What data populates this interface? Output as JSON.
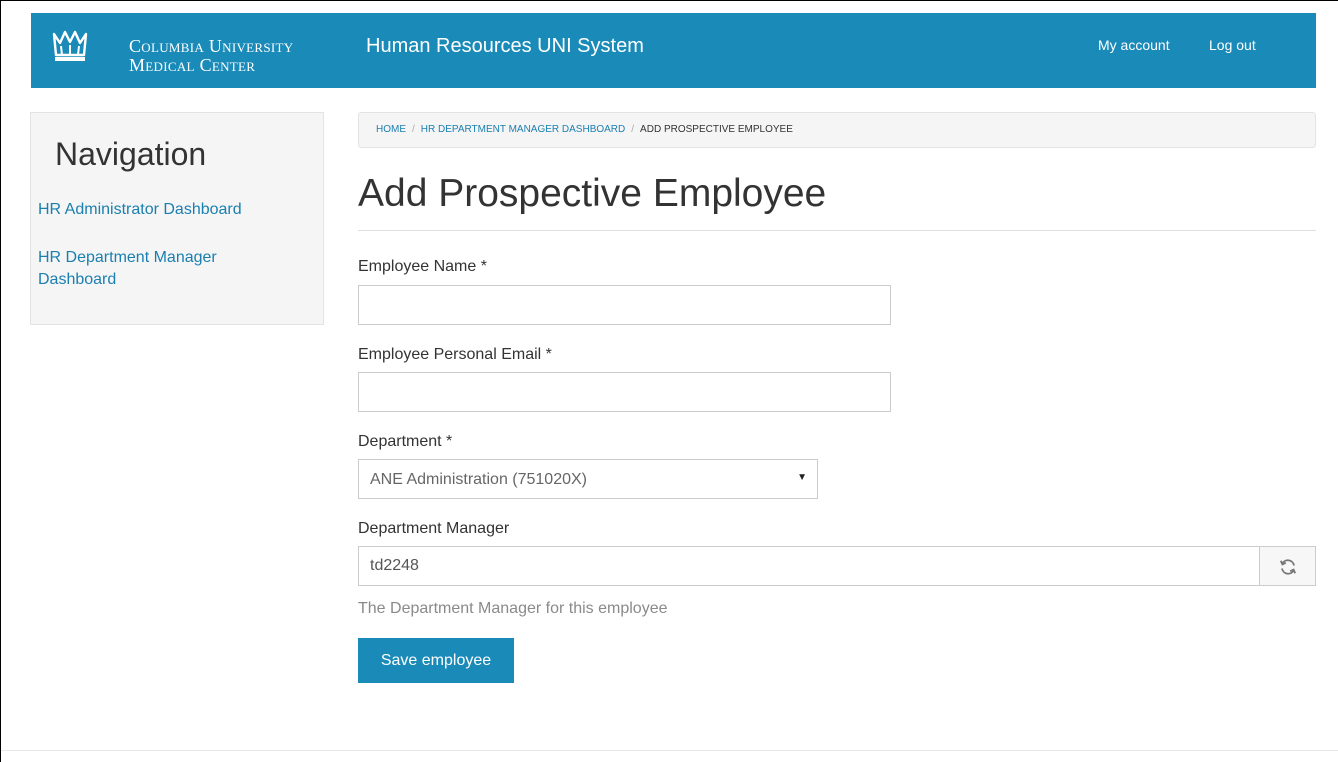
{
  "header": {
    "brand_line1": "Columbia University",
    "brand_line2": "Medical Center",
    "app_title": "Human Resources UNI System",
    "my_account": "My account",
    "log_out": "Log out",
    "background_color": "#1a8ab8",
    "logo_icon": "crown-icon"
  },
  "sidebar": {
    "heading": "Navigation",
    "items": [
      {
        "label": "HR Administrator Dashboard"
      },
      {
        "label": "HR Department Manager Dashboard"
      }
    ]
  },
  "breadcrumb": {
    "items": [
      {
        "label": "HOME"
      },
      {
        "label": "HR DEPARTMENT MANAGER DASHBOARD"
      },
      {
        "label": "ADD PROSPECTIVE EMPLOYEE"
      }
    ],
    "separator": "/"
  },
  "main": {
    "title": "Add Prospective Employee",
    "fields": {
      "employee_name": {
        "label": "Employee Name *",
        "value": ""
      },
      "personal_email": {
        "label": "Employee Personal Email *",
        "value": ""
      },
      "department": {
        "label": "Department *",
        "selected": "ANE Administration (751020X)"
      },
      "department_manager": {
        "label": "Department Manager",
        "value": "td2248",
        "help": "The Department Manager for this employee",
        "refresh_icon": "refresh-icon"
      }
    },
    "save_label": "Save employee"
  }
}
